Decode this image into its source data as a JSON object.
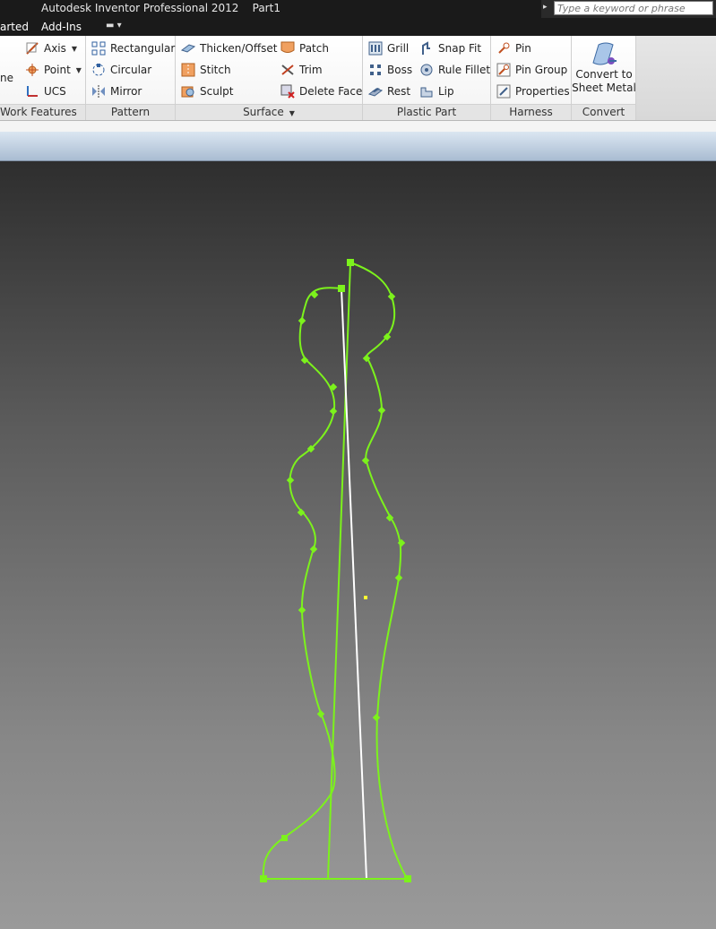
{
  "app": {
    "title": "Autodesk Inventor Professional 2012    Part1",
    "search_placeholder": "Type a keyword or phrase"
  },
  "tabs": [
    "arted",
    "Add-Ins"
  ],
  "ribbon": {
    "panels": {
      "work_features": {
        "label": "Work Features",
        "items": [
          "ne",
          "Axis",
          "Point",
          "UCS"
        ]
      },
      "pattern": {
        "label": "Pattern",
        "items": [
          "Rectangular",
          "Circular",
          "Mirror"
        ]
      },
      "surface": {
        "label": "Surface",
        "items": [
          "Thicken/Offset",
          "Stitch",
          "Sculpt",
          "Patch",
          "Trim",
          "Delete Face"
        ]
      },
      "plastic_part": {
        "label": "Plastic Part",
        "items": [
          "Grill",
          "Boss",
          "Rest",
          "Snap Fit",
          "Rule Fillet",
          "Lip"
        ]
      },
      "harness": {
        "label": "Harness",
        "items": [
          "Pin",
          "Pin Group",
          "Properties"
        ]
      },
      "convert": {
        "label": "Convert",
        "items": [
          "Convert to",
          "Sheet Metal"
        ]
      }
    }
  },
  "colors": {
    "sketch_green": "#7cf21c",
    "center_line": "#ffffff",
    "point_yellow": "#ffff33"
  }
}
